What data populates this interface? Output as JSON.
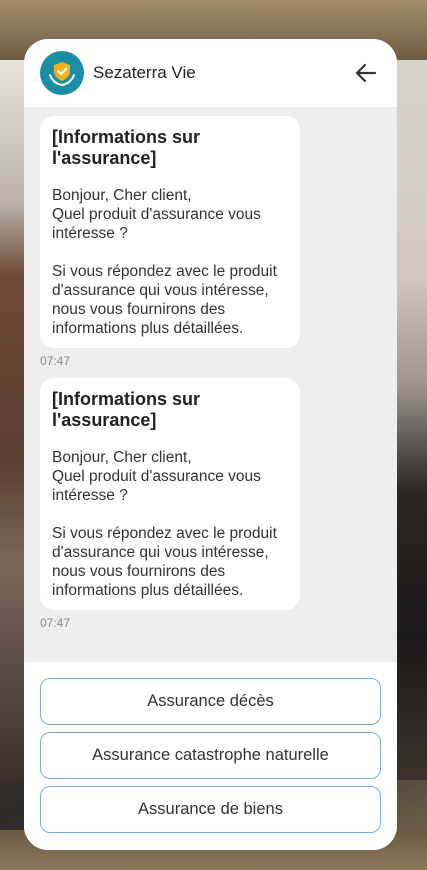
{
  "app": {
    "name": "Sezaterra Vie",
    "logo_icon": "shield-hands-icon",
    "back_icon": "arrow-left-icon",
    "accent_color": "#1a8fa3",
    "button_border_color": "#7fa8e6"
  },
  "messages": [
    {
      "title": "[Informations sur l'assurance]",
      "body": "Bonjour, Cher client,\nQuel produit d'assurance vous intéresse ?\n\nSi vous répondez avec le produit d'assurance qui vous intéresse, nous vous fournirons des informations plus détaillées.",
      "time": "07:47"
    },
    {
      "title": "[Informations sur l'assurance]",
      "body": "Bonjour, Cher client,\nQuel produit d'assurance vous intéresse ?\n\nSi vous répondez avec le produit d'assurance qui vous intéresse, nous vous fournirons des informations plus détaillées.",
      "time": "07:47"
    }
  ],
  "options": [
    {
      "label": "Assurance décès"
    },
    {
      "label": "Assurance catastrophe naturelle"
    },
    {
      "label": "Assurance de biens"
    }
  ]
}
